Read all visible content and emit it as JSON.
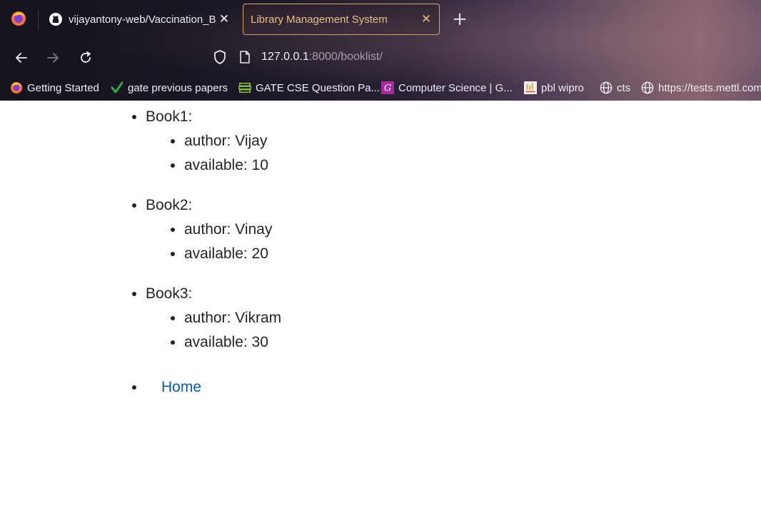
{
  "browser": {
    "tabs": [
      {
        "title": "vijayantony-web/Vaccination_Booking",
        "active": false,
        "icon": "github-icon"
      },
      {
        "title": "Library Management System",
        "active": true,
        "icon": "none"
      }
    ],
    "url": {
      "host": "127.0.0.1",
      "rest": ":8000/booklist/"
    },
    "bookmarks": [
      {
        "label": "Getting Started",
        "icon": "firefox-icon"
      },
      {
        "label": "gate previous papers",
        "icon": "checkmark-icon"
      },
      {
        "label": "GATE CSE Question Pa...",
        "icon": "books-icon"
      },
      {
        "label": "Computer Science | G...",
        "icon": "g-logo-icon"
      },
      {
        "label": "pbl wipro",
        "icon": "page-icon"
      },
      {
        "label": "cts",
        "icon": "globe-icon"
      },
      {
        "label": "https://tests.mettl.com",
        "icon": "globe-icon"
      }
    ],
    "colors": {
      "active_tab_text": "#f3c58a",
      "active_tab_border": "#d9a86a"
    }
  },
  "books": [
    {
      "name": "Book1:",
      "author": "author: Vijay",
      "available": "available: 10"
    },
    {
      "name": "Book2:",
      "author": "author: Vinay",
      "available": "available: 20"
    },
    {
      "name": "Book3:",
      "author": "author: Vikram",
      "available": "available: 30"
    }
  ],
  "nav": {
    "home_label": "Home"
  },
  "colors": {
    "link": "#0a5aa8",
    "text": "#212529"
  }
}
